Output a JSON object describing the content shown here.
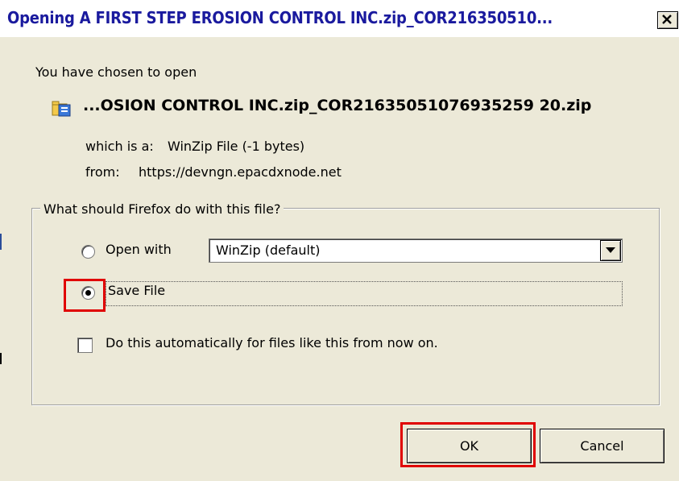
{
  "window": {
    "title": "Opening A FIRST STEP EROSION CONTROL INC.zip_COR216350510..."
  },
  "dialog": {
    "intro": "You have chosen to open",
    "file": {
      "icon": "zip-file-icon",
      "name": "...OSION CONTROL INC.zip_COR21635051076935259 20.zip",
      "type_label": "which is a:",
      "type_value": "WinZip File (-1 bytes)",
      "from_label": "from:",
      "from_value": "https://devngn.epacdxnode.net"
    },
    "action_group": {
      "legend": "What should Firefox do with this file?",
      "open_with": {
        "label": "Open with",
        "selected": false,
        "app": "WinZip (default)"
      },
      "save_file": {
        "label": "Save File",
        "selected": true
      },
      "auto_checkbox": {
        "label": "Do this automatically for files like this from now on.",
        "checked": false
      }
    },
    "buttons": {
      "ok": "OK",
      "cancel": "Cancel"
    }
  },
  "highlight_color": "#e00000"
}
